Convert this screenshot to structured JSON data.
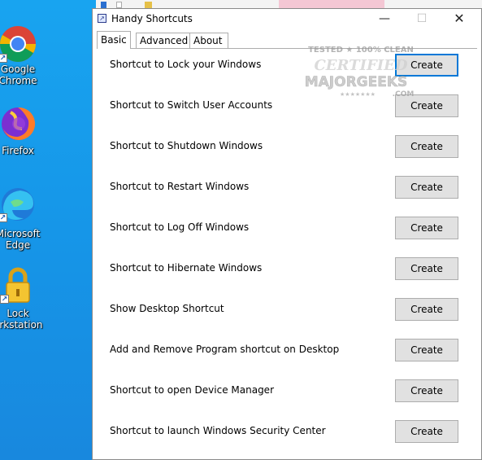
{
  "desktop": {
    "icons": [
      {
        "label_line1": "Google",
        "label_line2": "Chrome",
        "icon": "chrome-icon"
      },
      {
        "label_line1": "Firefox",
        "label_line2": "",
        "icon": "firefox-icon"
      },
      {
        "label_line1": "Microsoft",
        "label_line2": "Edge",
        "icon": "edge-icon"
      },
      {
        "label_line1": "Lock",
        "label_line2": "orkstation",
        "icon": "lock-icon"
      }
    ]
  },
  "window": {
    "title": "Handy Shortcuts",
    "controls": {
      "minimize": "—",
      "maximize": "☐",
      "close": "✕"
    },
    "tabs": [
      {
        "label": "Basic",
        "active": true
      },
      {
        "label": "Advanced",
        "active": false
      },
      {
        "label": "About",
        "active": false
      }
    ],
    "rows": [
      {
        "label": "Shortcut to Lock your Windows",
        "button": "Create"
      },
      {
        "label": "Shortcut to Switch User Accounts",
        "button": "Create"
      },
      {
        "label": "Shortcut to Shutdown Windows",
        "button": "Create"
      },
      {
        "label": "Shortcut to Restart Windows",
        "button": "Create"
      },
      {
        "label": "Shortcut to Log Off Windows",
        "button": "Create"
      },
      {
        "label": "Shortcut to Hibernate Windows",
        "button": "Create"
      },
      {
        "label": "Show Desktop Shortcut",
        "button": "Create"
      },
      {
        "label": "Add and Remove Program shortcut on Desktop",
        "button": "Create"
      },
      {
        "label": "Shortcut to open Device Manager",
        "button": "Create"
      },
      {
        "label": "Shortcut to launch Windows Security Center",
        "button": "Create"
      }
    ]
  },
  "watermark": {
    "line1": "TESTED ★ 100% CLEAN",
    "line2": "CERTIFIED",
    "line3": "MAJORGEEKS",
    "line4": ".COM"
  },
  "colors": {
    "accent": "#0078d7",
    "desktop": "#1696e8"
  }
}
